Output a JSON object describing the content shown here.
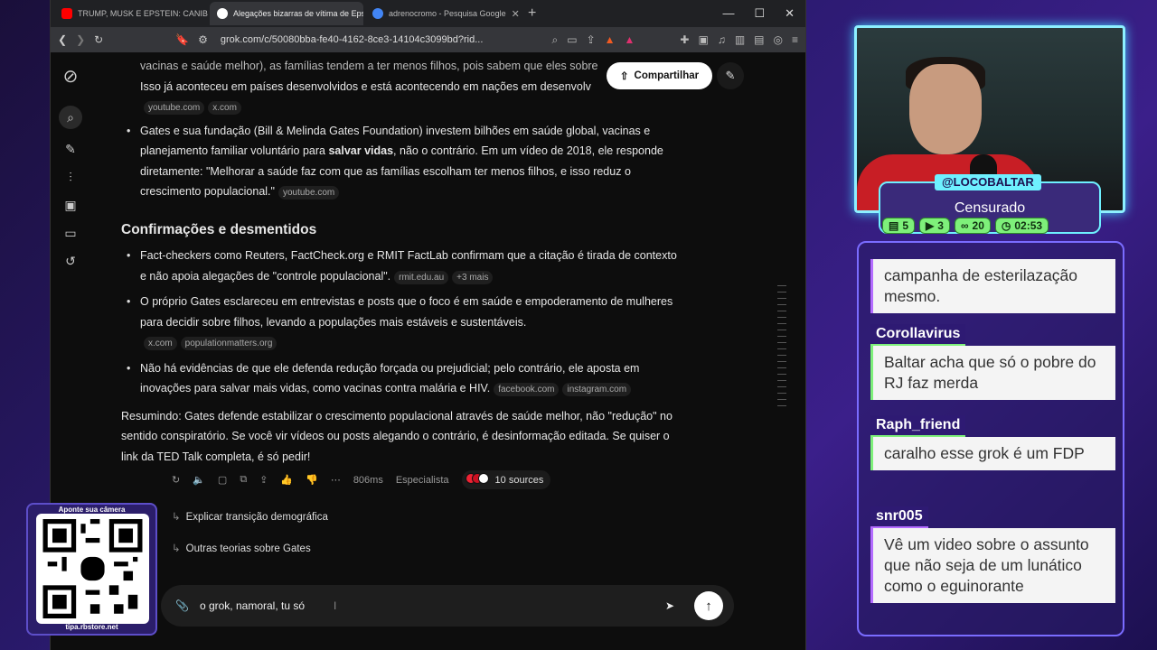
{
  "browser": {
    "tabs": [
      {
        "title": "TRUMP, MUSK E EPSTEIN: CANIBALISMO",
        "icon": "youtube-icon",
        "color": "#ff0000"
      },
      {
        "title": "Alegações bizarras de vítima de Epstein",
        "icon": "grok-icon",
        "color": "#ffffff"
      },
      {
        "title": "adrenocromo - Pesquisa Google",
        "icon": "google-icon",
        "color": "#4285f4"
      }
    ],
    "url": "grok.com/c/50080bba-fe40-4162-8ce3-14104c3099bd?rid..."
  },
  "page": {
    "share_label": "Compartilhar",
    "top_fragment": {
      "line1": "vacinas e saúde melhor), as famílias tendem a ter menos filhos, pois sabem que eles sobre",
      "line2": "Isso já aconteceu em países desenvolvidos e está acontecendo em nações em desenvolv",
      "cites": [
        "youtube.com",
        "x.com"
      ]
    },
    "bullet_gates": {
      "a": "Gates e sua fundação (Bill & Melinda Gates Foundation) investem bilhões em saúde global, vacinas e planejamento familiar voluntário para ",
      "bold": "salvar vidas",
      "b": ", não o contrário. Em um vídeo de 2018, ele responde diretamente: \"Melhorar a saúde faz com que as famílias escolham ter menos filhos, e isso reduz o crescimento populacional.\"",
      "cite": "youtube.com"
    },
    "heading": "Confirmações e desmentidos",
    "bullets": [
      {
        "text": "Fact-checkers como Reuters, FactCheck.org e RMIT FactLab confirmam que a citação é tirada de contexto e não apoia alegações de \"controle populacional\".",
        "cites": [
          "rmit.edu.au",
          "+3 mais"
        ]
      },
      {
        "text": "O próprio Gates esclareceu em entrevistas e posts que o foco é em saúde e empoderamento de mulheres para decidir sobre filhos, levando a populações mais estáveis e sustentáveis.",
        "cites": [
          "x.com",
          "populationmatters.org"
        ]
      },
      {
        "text": "Não há evidências de que ele defenda redução forçada ou prejudicial; pelo contrário, ele aposta em inovações para salvar mais vidas, como vacinas contra malária e HIV.",
        "cites": [
          "facebook.com",
          "instagram.com"
        ]
      }
    ],
    "summary": "Resumindo: Gates defende estabilizar o crescimento populacional através de saúde melhor, não \"redução\" no sentido conspiratório. Se você vir vídeos ou posts alegando o contrário, é desinformação editada. Se quiser o link da TED Talk completa, é só pedir!",
    "meta": {
      "time": "806ms",
      "mode": "Especialista",
      "sources": "10 sources"
    },
    "suggestions": [
      "Explicar transição demográfica",
      "Outras teorias sobre Gates"
    ],
    "input_value": "o grok, namoral, tu só "
  },
  "stream": {
    "handle": "@LOCOBALTAR",
    "status": "Censurado",
    "stats": [
      {
        "icon": "chat-icon",
        "value": "5"
      },
      {
        "icon": "video-icon",
        "value": "3"
      },
      {
        "icon": "link-icon",
        "value": "20"
      },
      {
        "icon": "clock-icon",
        "value": "02:53"
      }
    ],
    "chat": [
      {
        "user": "",
        "text": "campanha de esterilazação mesmo.",
        "accent": "#b46cff"
      },
      {
        "user": "Corollavirus",
        "text": "Baltar acha que só o pobre do RJ faz merda",
        "accent": "#7ef07a"
      },
      {
        "user": "Raph_friend",
        "text": "caralho esse grok é um FDP",
        "accent": "#7ef07a"
      },
      {
        "user": "snr005",
        "text": "Vê um video sobre o assunto que não seja de um lunático como o eguinorante",
        "accent": "#b46cff"
      }
    ],
    "qr": {
      "top": "Aponte sua câmera",
      "bottom": "tipa.rbstore.net"
    }
  }
}
